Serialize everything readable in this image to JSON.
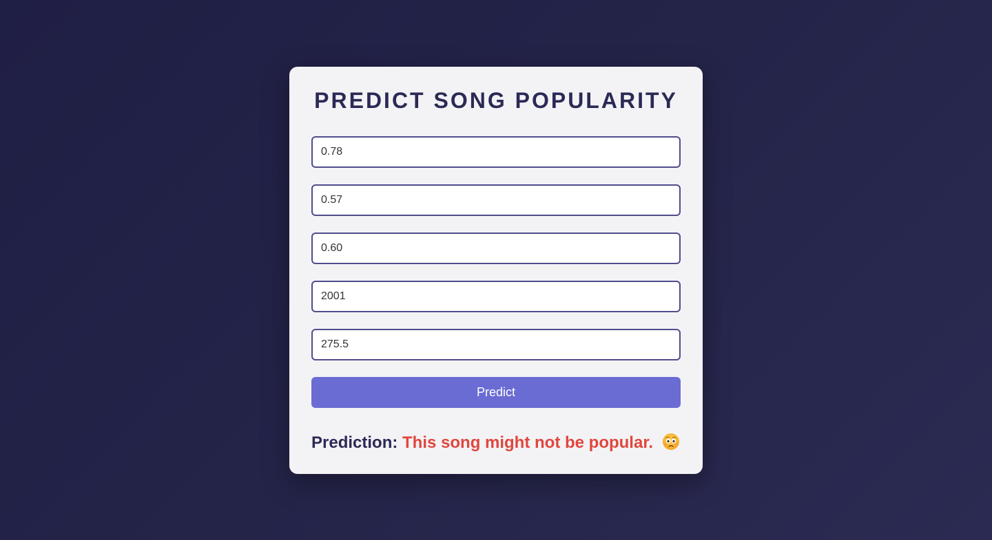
{
  "page": {
    "title": "PREDICT SONG POPULARITY"
  },
  "form": {
    "fields": [
      {
        "value": "0.78"
      },
      {
        "value": "0.57"
      },
      {
        "value": "0.60"
      },
      {
        "value": "2001"
      },
      {
        "value": "275.5"
      }
    ],
    "submit_label": "Predict"
  },
  "result": {
    "label": "Prediction:",
    "text": "This song might not be popular.",
    "icon": "worried-face-icon"
  },
  "colors": {
    "background": "#23224a",
    "card": "#f3f3f6",
    "title": "#2b2a55",
    "field_border": "#4f4c8c",
    "button": "#6b6bd4",
    "result_negative": "#e0473d"
  }
}
